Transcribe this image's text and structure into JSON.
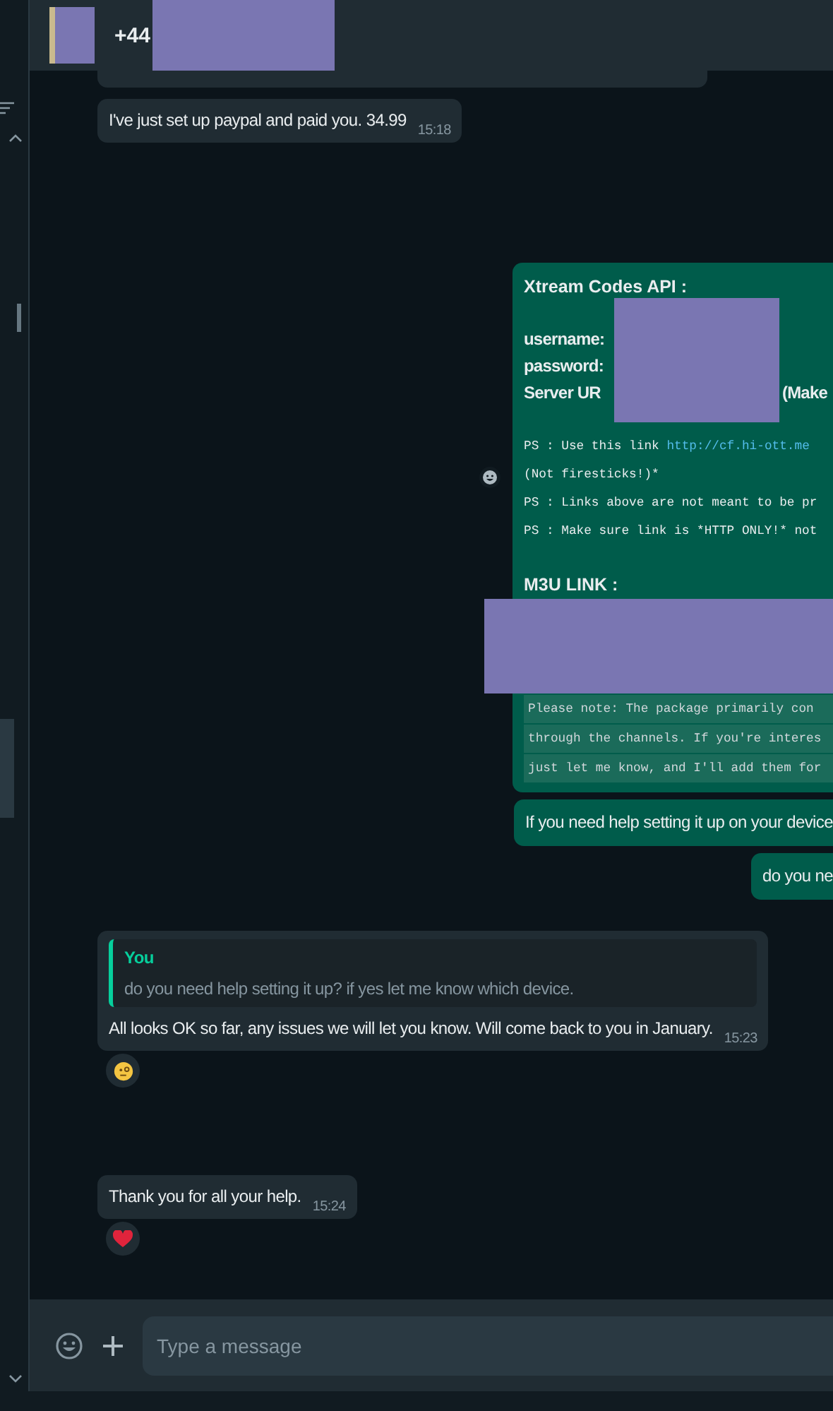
{
  "header": {
    "phone_prefix": "+44"
  },
  "messages": [
    {
      "kind": "clipped",
      "outgoing": false
    },
    {
      "kind": "text",
      "outgoing": false,
      "text": "I've just set up paypal and paid you. 34.99",
      "time": "15:18"
    },
    {
      "kind": "details",
      "outgoing": true,
      "title": "Xtream Codes API :",
      "fields": [
        "username:",
        "password:"
      ],
      "server_label": "Server UR",
      "server_note": "(Make",
      "ps_lines": [
        {
          "text": "PS : Use this link ",
          "link": "http://cf.hi-ott.me"
        },
        {
          "text": "(Not firesticks!)*"
        },
        {
          "text": "PS : Links above are not meant to be pr"
        },
        {
          "text": "PS : Make sure link is *HTTP ONLY!* not"
        }
      ],
      "m3u_title": "M3U LINK :",
      "note_lines": [
        "Please note: The package primarily con",
        "through the channels. If you're interes",
        "just let me know, and I'll add them for"
      ]
    },
    {
      "kind": "text",
      "outgoing": true,
      "text": "If you need help setting it up on your device"
    },
    {
      "kind": "text",
      "outgoing": true,
      "text": "do you ne"
    },
    {
      "kind": "reply",
      "outgoing": false,
      "quote_author": "You",
      "quote_text": "do you need help setting it up? if yes let me know which device.",
      "text": "All looks OK so far, any issues we will let you know. Will come back to you in January.",
      "time": "15:23",
      "reaction": {
        "kind": "face"
      }
    },
    {
      "kind": "text",
      "outgoing": false,
      "text": "Thank you for all your help.",
      "time": "15:24",
      "reaction": {
        "kind": "heart"
      }
    }
  ],
  "composer": {
    "placeholder": "Type a message"
  }
}
